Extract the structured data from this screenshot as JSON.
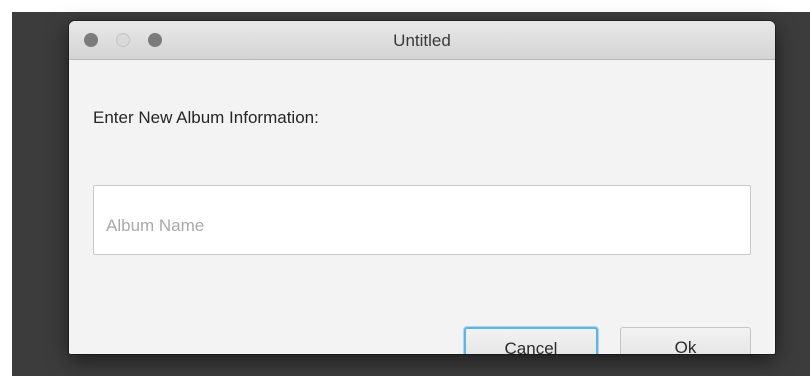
{
  "window": {
    "title": "Untitled"
  },
  "dialog": {
    "prompt": "Enter New Album Information:",
    "album_name": {
      "value": "",
      "placeholder": "Album Name"
    }
  },
  "buttons": {
    "cancel_label": "Cancel",
    "ok_label": "Ok"
  },
  "colors": {
    "focus_ring": "#5fb4e6",
    "traffic_light": "#7b7b7b"
  }
}
